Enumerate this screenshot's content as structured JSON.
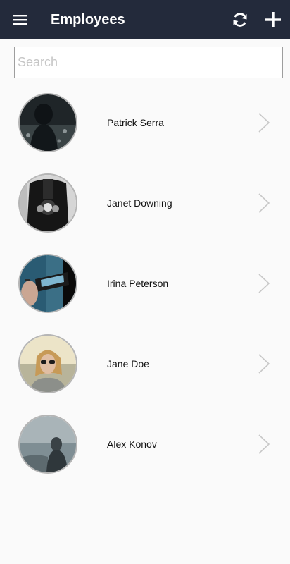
{
  "header": {
    "title": "Employees",
    "menu_icon": "hamburger-menu-icon",
    "refresh_icon": "refresh-icon",
    "add_icon": "plus-icon",
    "bg_color": "#232a3b"
  },
  "search": {
    "placeholder": "Search",
    "value": ""
  },
  "employees": [
    {
      "name": "Patrick Serra"
    },
    {
      "name": "Janet Downing"
    },
    {
      "name": "Irina Peterson"
    },
    {
      "name": "Jane Doe"
    },
    {
      "name": "Alex Konov"
    }
  ]
}
